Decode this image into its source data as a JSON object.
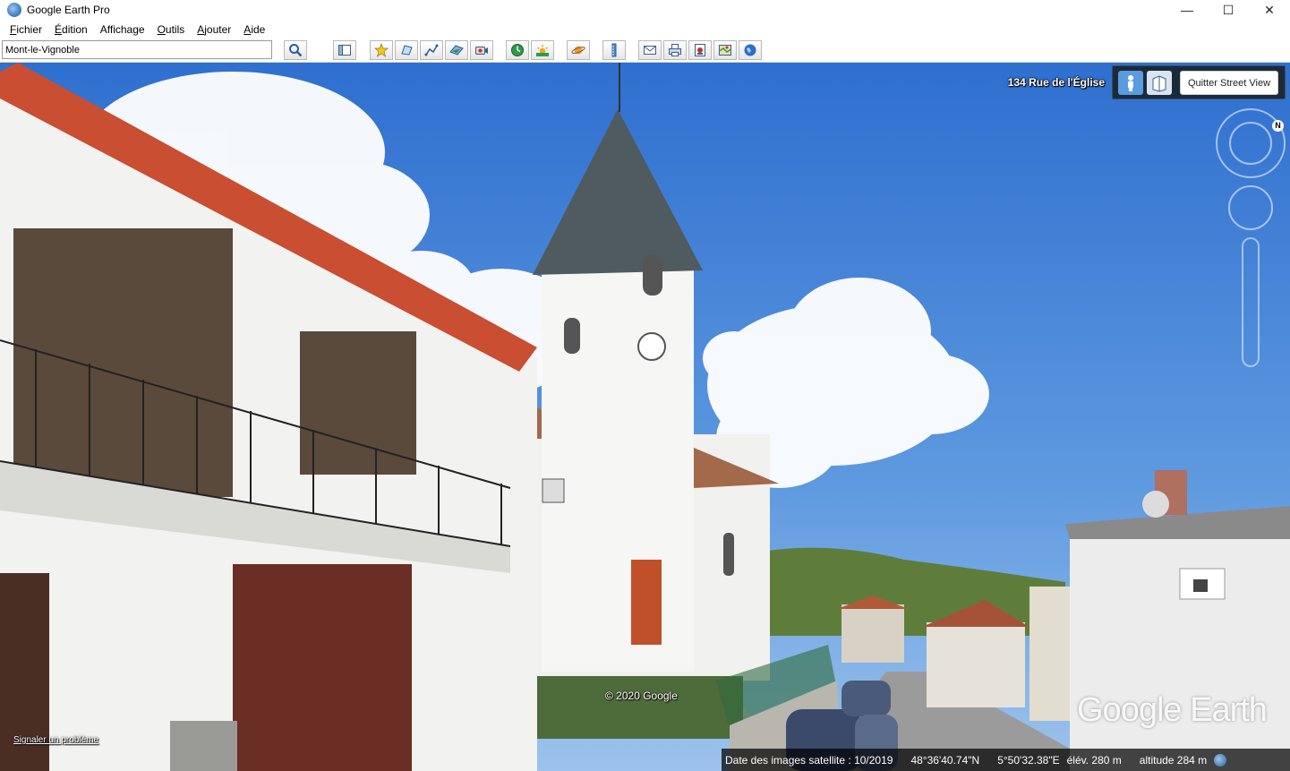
{
  "window": {
    "title": "Google Earth Pro",
    "controls": [
      "—",
      "☐",
      "✕"
    ]
  },
  "menu": [
    {
      "key": "F",
      "rest": "ichier"
    },
    {
      "key": "É",
      "rest": "dition"
    },
    {
      "key": "",
      "rest": "Affichage"
    },
    {
      "key": "O",
      "rest": "utils"
    },
    {
      "key": "A",
      "rest": "jouter"
    },
    {
      "key": "A",
      "rest": "ide"
    }
  ],
  "search": {
    "value": "Mont-le-Vignoble"
  },
  "toolbar_icons": [
    "search-icon",
    "sidebar-icon",
    "placemark-icon",
    "polygon-icon",
    "path-icon",
    "image-overlay-icon",
    "record-tour-icon",
    "historical-imagery-icon",
    "sunlight-icon",
    "planets-icon",
    "ruler-icon",
    "email-icon",
    "print-icon",
    "save-image-icon",
    "view-in-maps-icon",
    "earth-icon"
  ],
  "street_view": {
    "address": "134 Rue de l'Église",
    "quit_label": "Quitter Street View",
    "compass_north": "N"
  },
  "overlay": {
    "copyright": "© 2020 Google",
    "brand": "Google Earth",
    "report_problem": "Signaler un problème"
  },
  "status": {
    "imagery_date": "Date des images satellite : 10/2019",
    "latitude": "48°36'40.74\"N",
    "longitude": "5°50'32.38\"E",
    "elevation": "élév.  280 m",
    "altitude": "altitude    284 m"
  },
  "colors": {
    "sky": "#3f82d6",
    "status_bg": "#1b1b1b",
    "panel_bg": "#1b2a3a"
  }
}
